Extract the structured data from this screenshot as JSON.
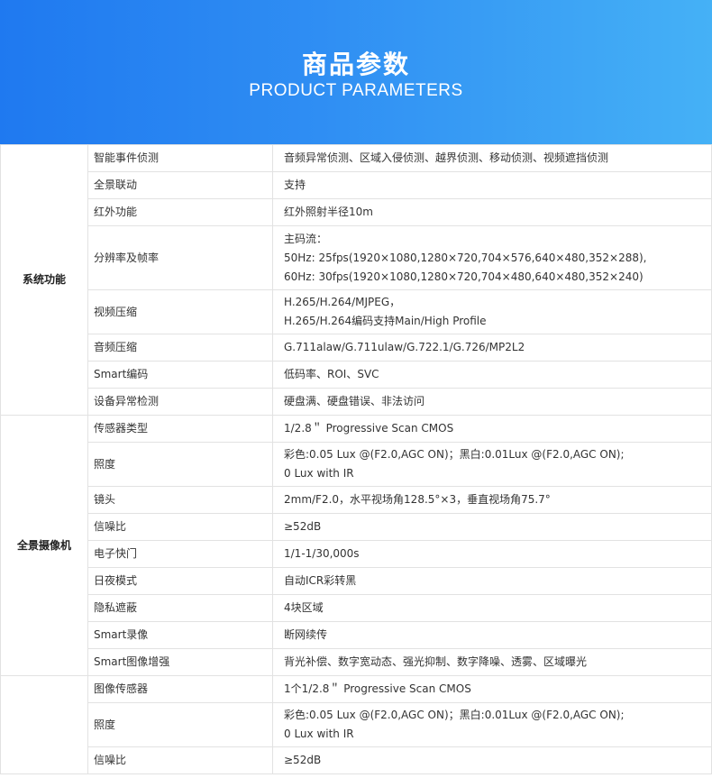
{
  "header": {
    "title_zh": "商品参数",
    "title_en": "PRODUCT PARAMETERS"
  },
  "groups": [
    {
      "name": "系统功能",
      "rows": [
        {
          "name": "智能事件侦测",
          "value": [
            "音频异常侦测、区域入侵侦测、越界侦测、移动侦测、视频遮挡侦测"
          ]
        },
        {
          "name": "全景联动",
          "value": [
            "支持"
          ]
        },
        {
          "name": "红外功能",
          "value": [
            "红外照射半径10m"
          ]
        },
        {
          "name": "分辨率及帧率",
          "value": [
            "主码流：",
            "50Hz: 25fps(1920×1080,1280×720,704×576,640×480,352×288),",
            "60Hz: 30fps(1920×1080,1280×720,704×480,640×480,352×240)"
          ]
        },
        {
          "name": "视频压缩",
          "value": [
            "H.265/H.264/MJPEG，",
            "H.265/H.264编码支持Main/High Profile"
          ]
        },
        {
          "name": "音频压缩",
          "value": [
            "G.711alaw/G.711ulaw/G.722.1/G.726/MP2L2"
          ]
        },
        {
          "name": "Smart编码",
          "value": [
            "低码率、ROI、SVC"
          ]
        },
        {
          "name": "设备异常检测",
          "value": [
            "硬盘满、硬盘错误、非法访问"
          ]
        }
      ]
    },
    {
      "name": "全景摄像机",
      "rows": [
        {
          "name": "传感器类型",
          "value": [
            "1/2.8＂ Progressive Scan CMOS"
          ]
        },
        {
          "name": "照度",
          "value": [
            "彩色:0.05 Lux @(F2.0,AGC ON)；黑白:0.01Lux @(F2.0,AGC ON);",
            " 0 Lux with IR"
          ]
        },
        {
          "name": "镜头",
          "value": [
            "2mm/F2.0，水平视场角128.5°×3，垂直视场角75.7°"
          ]
        },
        {
          "name": "信噪比",
          "value": [
            "≥52dB"
          ]
        },
        {
          "name": "电子快门",
          "value": [
            "1/1-1/30,000s"
          ]
        },
        {
          "name": "日夜模式",
          "value": [
            "自动ICR彩转黑"
          ]
        },
        {
          "name": "隐私遮蔽",
          "value": [
            "4块区域"
          ]
        },
        {
          "name": "Smart录像",
          "value": [
            "断网续传"
          ]
        },
        {
          "name": "Smart图像增强",
          "value": [
            "背光补偿、数字宽动态、强光抑制、数字降噪、透雾、区域曝光"
          ]
        }
      ]
    },
    {
      "name": "",
      "rows": [
        {
          "name": "图像传感器",
          "value": [
            "1个1/2.8＂ Progressive Scan CMOS"
          ]
        },
        {
          "name": "照度",
          "value": [
            "彩色:0.05 Lux @(F2.0,AGC ON)；黑白:0.01Lux @(F2.0,AGC ON);",
            " 0 Lux with IR"
          ]
        },
        {
          "name": "信噪比",
          "value": [
            "≥52dB"
          ]
        }
      ]
    }
  ]
}
